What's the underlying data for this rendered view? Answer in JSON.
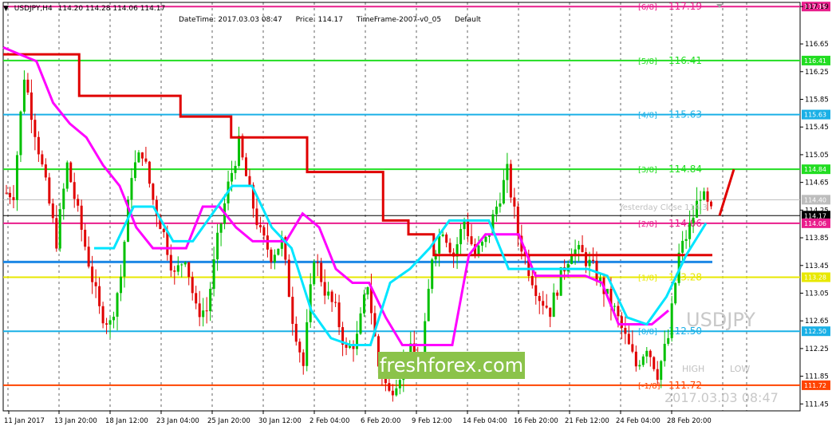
{
  "header": {
    "symbol": "USDJPY,H4",
    "ohlc": "114.20 114.28 114.06 114.17"
  },
  "info": {
    "datetime": "DateTime: 2017.03.03 08:47",
    "price": "Price: 114.17",
    "timeframe": "TimeFrame-2007-v0_05",
    "mode": "Default"
  },
  "watermark": {
    "symbol": "USDJPY",
    "brand": "freshforex.com",
    "high": "HIGH",
    "low": "LOW",
    "datetime": "2017.03.03 08:47",
    "yesterday_close": "Yesterday Close 114.3"
  },
  "chart_data": {
    "type": "candlestick",
    "symbol": "USDJPY",
    "timeframe": "H4",
    "ylim": [
      111.35,
      117.25
    ],
    "y_ticks": [
      "117.19",
      "116.65",
      "116.25",
      "115.85",
      "115.45",
      "115.05",
      "114.65",
      "114.25",
      "113.85",
      "113.45",
      "113.05",
      "112.65",
      "112.25",
      "111.85",
      "111.45"
    ],
    "x_ticks": [
      "11 Jan 2017",
      "13 Jan 20:00",
      "18 Jan 12:00",
      "23 Jan 04:00",
      "25 Jan 20:00",
      "30 Jan 12:00",
      "2 Feb 04:00",
      "6 Feb 20:00",
      "9 Feb 12:00",
      "14 Feb 04:00",
      "16 Feb 20:00",
      "21 Feb 12:00",
      "24 Feb 04:00",
      "28 Feb 20:00"
    ],
    "murrey_levels": [
      {
        "label": "[6/8]",
        "value": 117.19,
        "tag": "117.19",
        "color": "#e91e8c"
      },
      {
        "label": "[5/8]",
        "value": 116.41,
        "tag": "116.41",
        "color": "#22dd22"
      },
      {
        "label": "[4/8]",
        "value": 115.63,
        "tag": "115.63",
        "color": "#1ab0e6"
      },
      {
        "label": "[3/8]",
        "value": 114.84,
        "tag": "114.84",
        "color": "#22dd22"
      },
      {
        "label": "[2/8]",
        "value": 114.06,
        "tag": "114.06",
        "color": "#e91e8c"
      },
      {
        "label": "[1/8]",
        "value": 113.28,
        "tag": "113.28",
        "color": "#e8e800"
      },
      {
        "label": "[0/8]",
        "value": 112.5,
        "tag": "112.50",
        "color": "#1ab0e6"
      },
      {
        "label": "[-1/8]",
        "value": 111.72,
        "tag": "111.72",
        "color": "#ff4400"
      }
    ],
    "extra_lines": [
      {
        "value": 114.4,
        "tag": "114.40",
        "color": "#bdbdbd"
      },
      {
        "value": 114.17,
        "tag": "114.17",
        "color": "#000000"
      },
      {
        "value": 113.5,
        "tag": "",
        "color": "#1e88e5"
      }
    ],
    "ohlc_close_path": [
      114.5,
      116.2,
      115.4,
      114.6,
      113.8,
      114.9,
      114.2,
      113.5,
      112.8,
      112.6,
      113.3,
      114.8,
      115.1,
      114.4,
      113.9,
      113.3,
      113.6,
      112.8,
      112.8,
      113.8,
      114.6,
      115.2,
      114.5,
      113.9,
      113.6,
      113.8,
      112.7,
      112.0,
      113.6,
      113.1,
      112.8,
      112.2,
      112.4,
      113.2,
      112.0,
      111.6,
      111.9,
      112.2,
      112.0,
      113.6,
      114.0,
      113.6,
      114.1,
      113.6,
      113.8,
      114.3,
      114.8,
      113.9,
      113.4,
      113.0,
      112.8,
      113.3,
      113.7,
      113.6,
      113.4,
      113.1,
      112.8,
      112.4,
      112.0,
      112.3,
      111.9,
      112.4,
      113.6,
      114.0,
      114.5,
      114.2
    ],
    "red_step_line": [
      116.5,
      116.5,
      116.5,
      115.9,
      115.9,
      115.9,
      115.9,
      115.6,
      115.6,
      115.3,
      115.3,
      115.3,
      114.8,
      114.8,
      114.8,
      114.1,
      113.9,
      113.6,
      113.6,
      113.6,
      113.6,
      113.6,
      113.6,
      113.6,
      113.6,
      113.6,
      113.6,
      113.6
    ],
    "magenta_line": [
      116.6,
      116.5,
      116.4,
      115.8,
      115.5,
      115.3,
      114.9,
      114.6,
      114.0,
      113.7,
      113.7,
      113.7,
      114.3,
      114.3,
      114.0,
      113.8,
      113.8,
      113.8,
      114.2,
      114.0,
      113.4,
      113.2,
      113.2,
      112.7,
      112.3,
      112.3,
      112.3,
      112.3,
      113.6,
      113.9,
      113.9,
      113.9,
      113.3,
      113.3,
      113.3,
      113.3,
      113.2,
      112.6,
      112.6,
      112.6,
      112.8
    ],
    "cyan_line": [
      113.7,
      113.7,
      114.3,
      114.3,
      113.8,
      113.8,
      114.2,
      114.6,
      114.6,
      114.0,
      113.7,
      112.8,
      112.4,
      112.3,
      112.3,
      113.2,
      113.4,
      113.7,
      114.1,
      114.1,
      114.1,
      113.4,
      113.4,
      113.4,
      113.4,
      113.4,
      113.3,
      112.7,
      112.6,
      113.0,
      113.6,
      114.06
    ],
    "forecast_line": [
      [
        114.17
      ],
      [
        114.84
      ]
    ]
  }
}
